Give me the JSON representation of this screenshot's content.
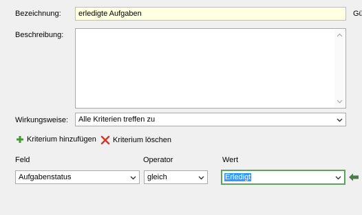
{
  "form": {
    "name_label": "Bezeichnung:",
    "name_value": "erledigte Aufgaben",
    "cut_label": "Gü",
    "description_label": "Beschreibung:",
    "description_value": "",
    "mode_label": "Wirkungsweise:",
    "mode_value": "Alle Kriterien treffen zu"
  },
  "toolbar": {
    "add_label": "Kriterium hinzufügen",
    "delete_label": "Kriterium löschen"
  },
  "criteria": {
    "headers": {
      "field": "Feld",
      "operator": "Operator",
      "value": "Wert"
    },
    "row": {
      "field": "Aufgabenstatus",
      "operator": "gleich",
      "value": "Erledigt"
    }
  },
  "colors": {
    "name_bg": "#ffffe1",
    "add_icon": "#3f9a2f",
    "delete_icon": "#d03a2a",
    "focus_border": "#5ba35b",
    "selection": "#3399ff",
    "arrow": "#4f7a4f"
  },
  "icons": {
    "add": "plus-icon",
    "delete": "x-icon",
    "dropdown": "chevron-down-icon",
    "row_pointer": "arrow-left-icon"
  }
}
